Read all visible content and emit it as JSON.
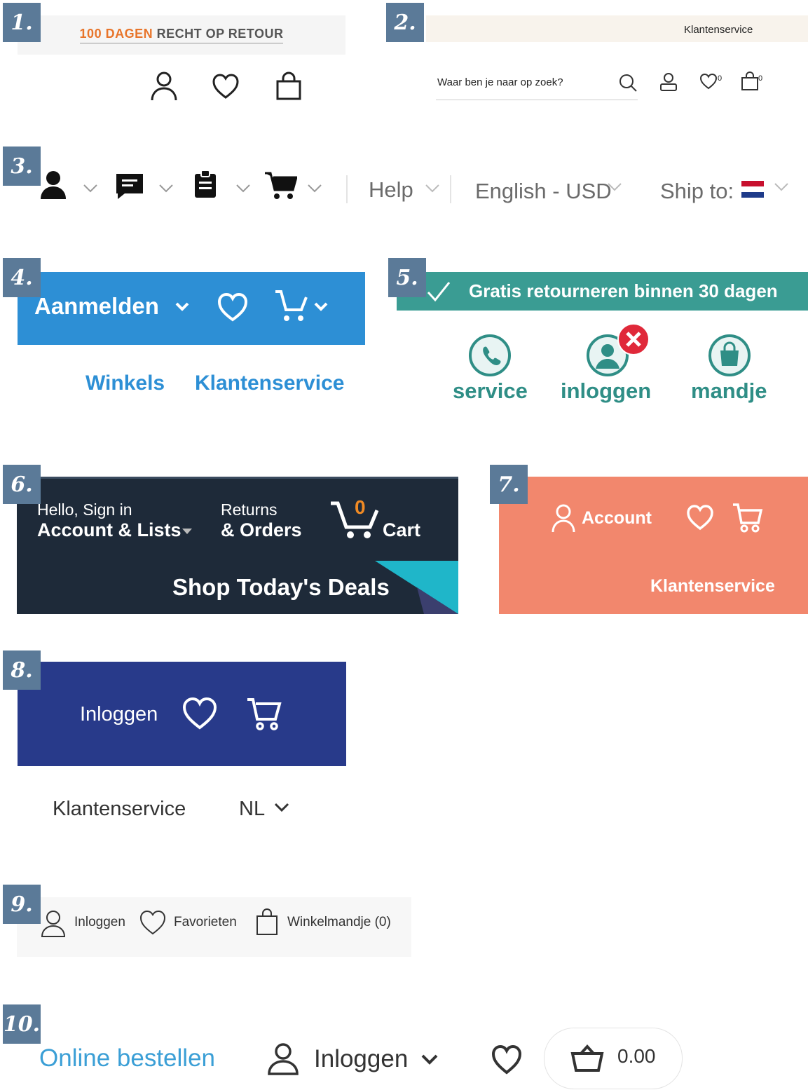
{
  "labels": [
    "1.",
    "2.",
    "3.",
    "4.",
    "5.",
    "6.",
    "7.",
    "8.",
    "9.",
    "10."
  ],
  "p1": {
    "banner_highlight": "100 DAGEN",
    "banner_rest": " RECHT OP RETOUR"
  },
  "p2": {
    "top_link": "Klantenservice",
    "search_placeholder": "Waar ben je naar op zoek?",
    "fav_count": "0",
    "bag_count": "0"
  },
  "p3": {
    "help": "Help",
    "language_currency": "English - USD",
    "ship_to": "Ship to:"
  },
  "p4": {
    "signin": "Aanmelden",
    "link_stores": "Winkels",
    "link_service": "Klantenservice"
  },
  "p5": {
    "banner": "Gratis retourneren binnen 30 dagen",
    "service": "service",
    "login": "inloggen",
    "cart": "mandje"
  },
  "p6": {
    "hello": "Hello, Sign in",
    "account": "Account & Lists",
    "returns": "Returns",
    "orders": "& Orders",
    "cart_count": "0",
    "cart": "Cart",
    "deals": "Shop Today's Deals"
  },
  "p7": {
    "account": "Account",
    "service": "Klantenservice"
  },
  "p8": {
    "login": "Inloggen",
    "service": "Klantenservice",
    "language": "NL"
  },
  "p9": {
    "login": "Inloggen",
    "favorites": "Favorieten",
    "cart": "Winkelmandje (0)"
  },
  "p10": {
    "order_online": "Online bestellen",
    "login": "Inloggen",
    "cart_amount": "0.00"
  },
  "colors": {
    "label_bg": "#5b7a98",
    "p4_blue": "#2d8fd5",
    "p5_teal": "#3a9c93",
    "p6_navy": "#1e2a39",
    "p7_salmon": "#f2876d",
    "p8_blue": "#283a8a"
  },
  "icons": [
    "user-icon",
    "heart-icon",
    "bag-icon",
    "search-icon",
    "chat-icon",
    "clipboard-icon",
    "cart-icon",
    "chevron-down-icon",
    "flag-nl-icon",
    "check-icon",
    "phone-icon",
    "close-icon",
    "basket-icon"
  ]
}
